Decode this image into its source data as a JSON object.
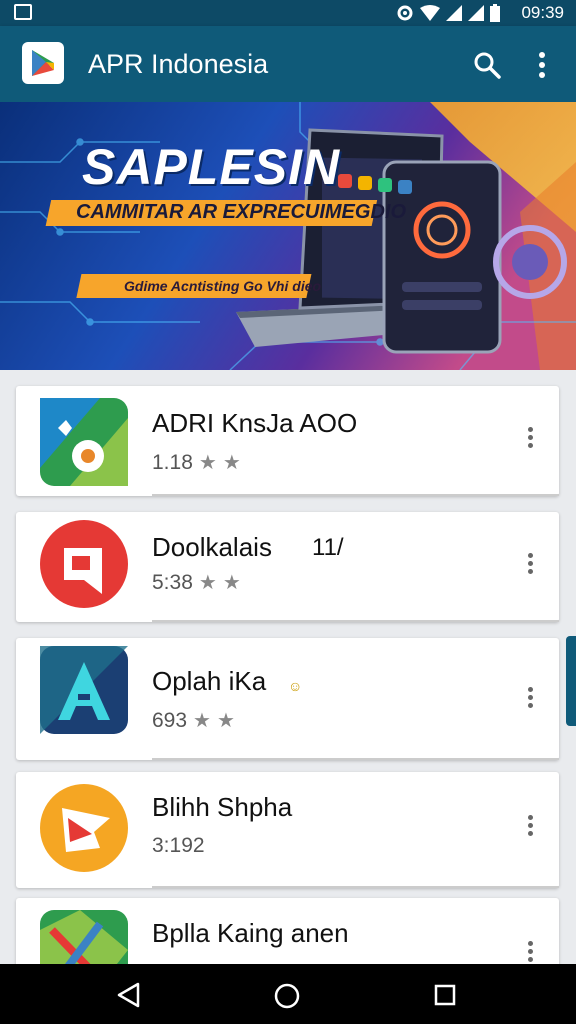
{
  "status_bar": {
    "time": "09:39"
  },
  "app_bar": {
    "title": "APR Indonesia"
  },
  "banner": {
    "headline": "SAPLESIN",
    "subheadline": "CAMMITAR AR EXPRECUIMEGDIO",
    "tagline": "Gdime Acntisting Go Vhi dieo"
  },
  "apps": [
    {
      "name": "ADRI KnsJa AOO",
      "meta": "1.18",
      "stars": 2,
      "extra": ""
    },
    {
      "name": "Doolkalais",
      "meta": "5:38",
      "stars": 2,
      "extra": "11/"
    },
    {
      "name": "Oplah iKa",
      "meta": "693",
      "stars": 2,
      "extra": ""
    },
    {
      "name": "Blihh Shpha",
      "meta": "3:192",
      "stars": 0,
      "extra": ""
    },
    {
      "name": "Bplla Kaing anen",
      "meta": "",
      "stars": 0,
      "extra": ""
    }
  ],
  "icons": {
    "status_left": "image-icon",
    "status_right": [
      "settings-icon",
      "wifi-icon",
      "signal-icon",
      "signal-icon",
      "battery-icon"
    ],
    "app_bar": [
      "app-logo-icon",
      "search-icon",
      "more-vert-icon"
    ],
    "nav": [
      "back-icon",
      "home-icon",
      "recents-icon"
    ]
  },
  "colors": {
    "app_bar": "#0f5a79",
    "status_bar": "#0d4a66",
    "accent_orange": "#f5a623"
  }
}
